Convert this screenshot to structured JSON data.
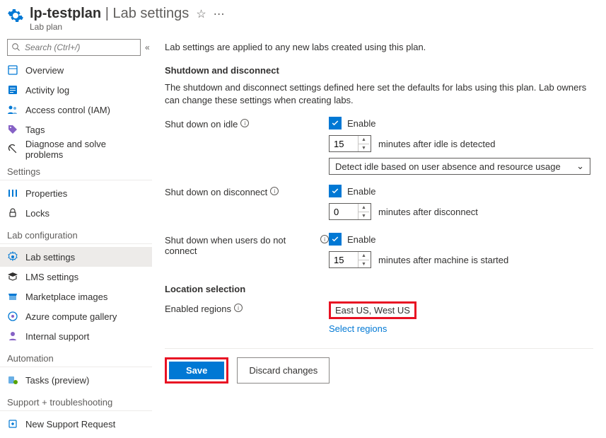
{
  "header": {
    "name": "lp-testplan",
    "separator": "|",
    "page": "Lab settings",
    "subtitle": "Lab plan"
  },
  "search": {
    "placeholder": "Search (Ctrl+/)"
  },
  "nav": {
    "overview": "Overview",
    "activity": "Activity log",
    "iam": "Access control (IAM)",
    "tags": "Tags",
    "diagnose": "Diagnose and solve problems",
    "settings_h": "Settings",
    "properties": "Properties",
    "locks": "Locks",
    "labconf_h": "Lab configuration",
    "labsettings": "Lab settings",
    "lms": "LMS settings",
    "marketplace": "Marketplace images",
    "gallery": "Azure compute gallery",
    "support": "Internal support",
    "automation_h": "Automation",
    "tasks": "Tasks (preview)",
    "trouble_h": "Support + troubleshooting",
    "newsupport": "New Support Request"
  },
  "content": {
    "intro": "Lab settings are applied to any new labs created using this plan.",
    "shutdown_h": "Shutdown and disconnect",
    "shutdown_desc": "The shutdown and disconnect settings defined here set the defaults for labs using this plan. Lab owners can change these settings when creating labs.",
    "idle_label": "Shut down on idle",
    "enable": "Enable",
    "idle_minutes": "15",
    "idle_suffix": "minutes after idle is detected",
    "idle_dropdown": "Detect idle based on user absence and resource usage",
    "disconnect_label": "Shut down on disconnect",
    "disconnect_minutes": "0",
    "disconnect_suffix": "minutes after disconnect",
    "noconnect_label": "Shut down when users do not connect",
    "noconnect_minutes": "15",
    "noconnect_suffix": "minutes after machine is started",
    "location_h": "Location selection",
    "regions_label": "Enabled regions",
    "regions_value": "East US, West US",
    "select_regions": "Select regions",
    "save": "Save",
    "discard": "Discard changes"
  }
}
